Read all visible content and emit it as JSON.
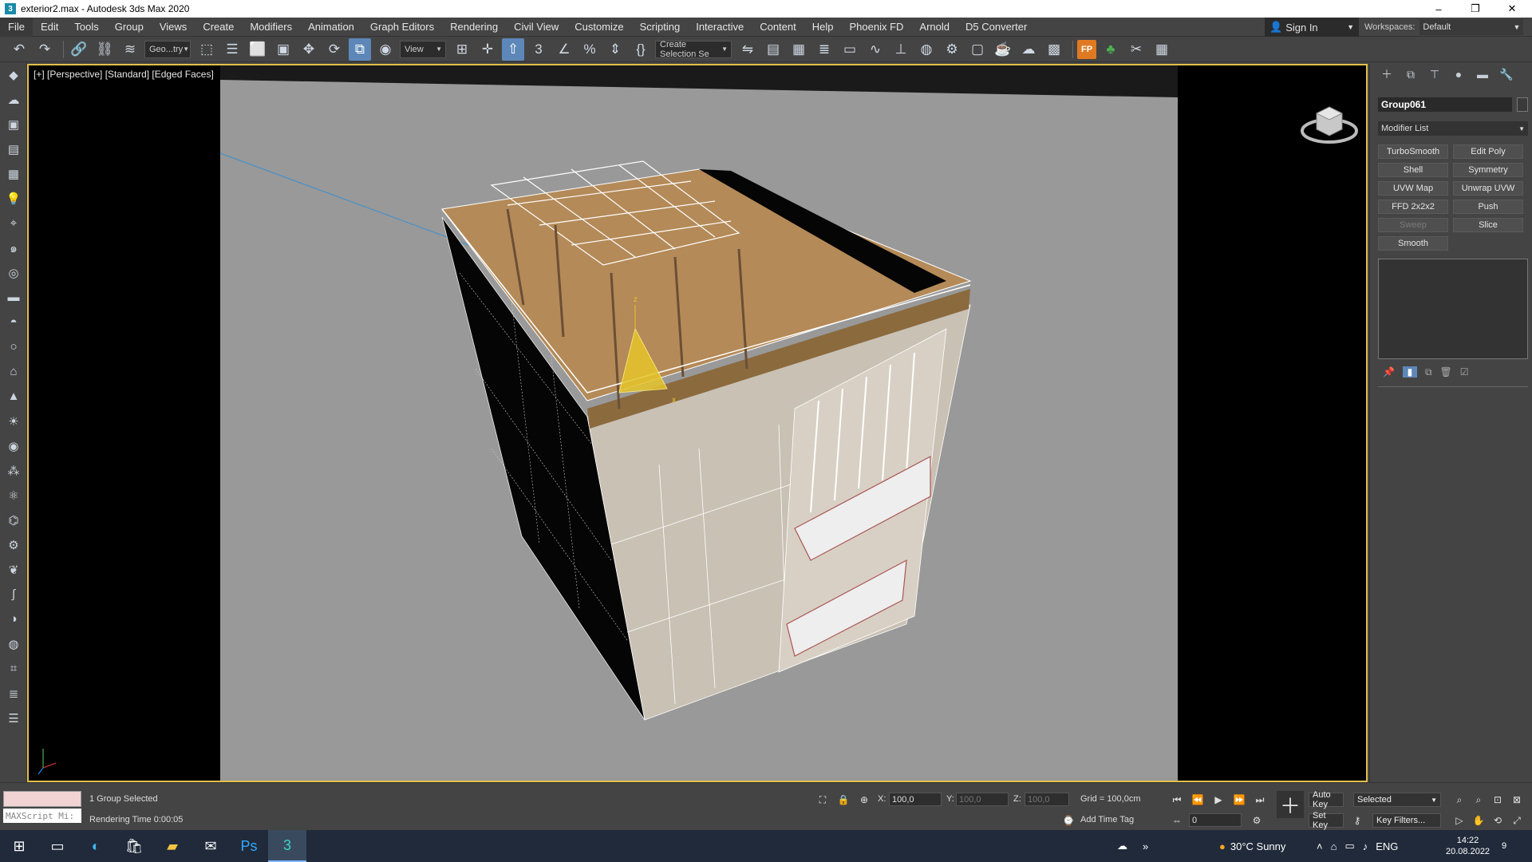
{
  "window": {
    "title": "exterior2.max - Autodesk 3ds Max 2020",
    "app_icon": "3",
    "minimize": "–",
    "maximize": "❐",
    "close": "✕"
  },
  "menu": [
    "File",
    "Edit",
    "Tools",
    "Group",
    "Views",
    "Create",
    "Modifiers",
    "Animation",
    "Graph Editors",
    "Rendering",
    "Civil View",
    "Customize",
    "Scripting",
    "Interactive",
    "Content",
    "Help",
    "Phoenix FD",
    "Arnold",
    "D5 Converter"
  ],
  "account": {
    "sign_in": "Sign In"
  },
  "workspaces": {
    "label": "Workspaces:",
    "value": "Default"
  },
  "toolbar": {
    "filter_value": "Geo...try",
    "ref_coord": "View",
    "selection_set": "Create Selection Se",
    "snap_angle": "3",
    "fp_label": "FP"
  },
  "viewport": {
    "label": "[+] [Perspective] [Standard] [Edged Faces]",
    "accent": "#e2c04a",
    "bg_outer": "#000000",
    "bg_inner": "#999999",
    "gizmo_z": "z",
    "gizmo_x": "x"
  },
  "command_panel": {
    "object_name": "Group061",
    "modifier_list": "Modifier List",
    "modifiers": [
      {
        "label": "TurboSmooth",
        "enabled": true
      },
      {
        "label": "Edit Poly",
        "enabled": true
      },
      {
        "label": "Shell",
        "enabled": true
      },
      {
        "label": "Symmetry",
        "enabled": true
      },
      {
        "label": "UVW Map",
        "enabled": true
      },
      {
        "label": "Unwrap UVW",
        "enabled": true
      },
      {
        "label": "FFD 2x2x2",
        "enabled": true
      },
      {
        "label": "Push",
        "enabled": true
      },
      {
        "label": "Sweep",
        "enabled": false
      },
      {
        "label": "Slice",
        "enabled": true
      },
      {
        "label": "Smooth",
        "enabled": true
      }
    ]
  },
  "status": {
    "maxscript_placeholder": "MAXScript Mi:",
    "selection": "1 Group Selected",
    "rendering_time": "Rendering Time  0:00:05",
    "x_label": "X:",
    "x_value": "100,0",
    "y_label": "Y:",
    "y_value": "100,0",
    "z_label": "Z:",
    "z_value": "100,0",
    "grid": "Grid = 100,0cm",
    "add_time_tag": "Add Time Tag",
    "auto_key": "Auto Key",
    "set_key": "Set Key",
    "key_mode": "Selected",
    "key_filters": "Key Filters...",
    "frame": "0"
  },
  "taskbar": {
    "weather": "30°C  Sunny",
    "lang": "ENG",
    "time": "14:22",
    "date": "20.08.2022",
    "notifications": "9"
  }
}
